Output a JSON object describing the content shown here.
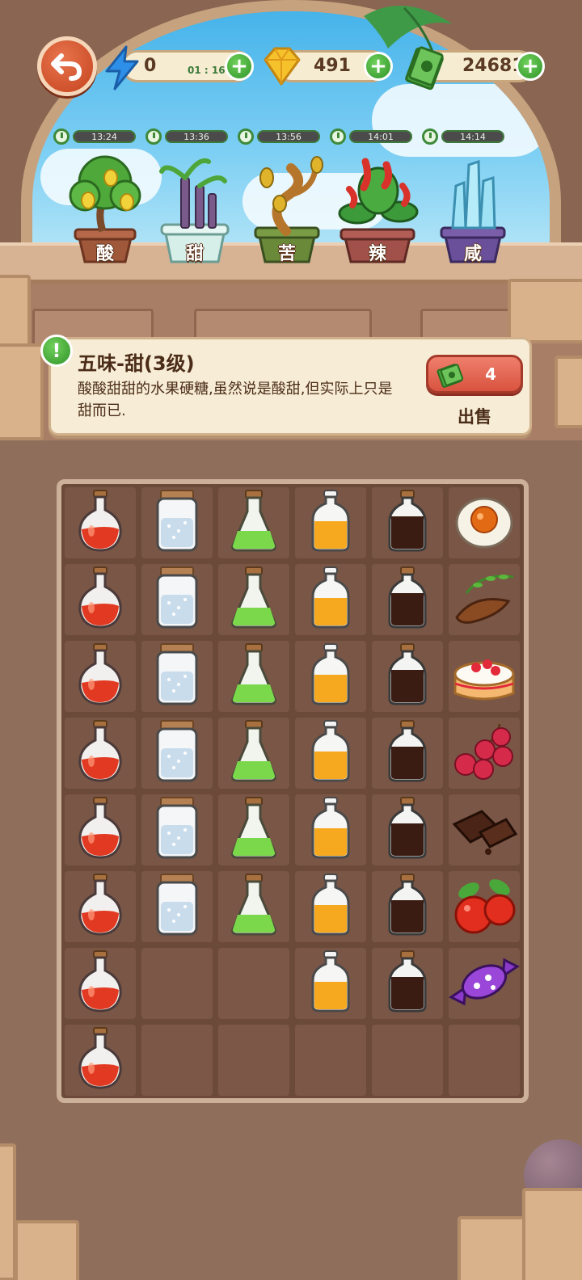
{
  "hud": {
    "energy": {
      "value": "0",
      "timer": "01 : 16",
      "icon": "lightning-bolt-icon"
    },
    "gems": {
      "value": "491",
      "icon": "gold-gem-icon"
    },
    "cash": {
      "value": "24681",
      "icon": "cash-stack-icon"
    },
    "plus_label": "+"
  },
  "plants": [
    {
      "id": "sour",
      "label": "酸",
      "timer": "13:24",
      "icon": "lemon-tree-icon"
    },
    {
      "id": "sweet",
      "label": "甜",
      "timer": "13:36",
      "icon": "sugarcane-icon"
    },
    {
      "id": "bitter",
      "label": "苦",
      "timer": "13:56",
      "icon": "bitter-gourd-tree-icon"
    },
    {
      "id": "spicy",
      "label": "辣",
      "timer": "14:01",
      "icon": "chili-plant-icon"
    },
    {
      "id": "salty",
      "label": "咸",
      "timer": "14:14",
      "icon": "salt-crystal-icon"
    }
  ],
  "info": {
    "badge": "!",
    "title": "五味-甜(3级)",
    "description": "酸酸甜甜的水果硬糖,虽然说是酸甜,但实际上只是甜而已.",
    "price": "4",
    "sell_label": "出售"
  },
  "grid": {
    "columns": [
      {
        "item": "red-potion-flask-icon",
        "count": 8
      },
      {
        "item": "sugar-jar-icon",
        "count": 6
      },
      {
        "item": "green-potion-flask-icon",
        "count": 6
      },
      {
        "item": "orange-juice-bottle-icon",
        "count": 7
      },
      {
        "item": "soy-sauce-bottle-icon",
        "count": 7
      }
    ],
    "last_column": [
      "salted-egg-icon",
      "tamarind-icon",
      "strawberry-cake-icon",
      "lychee-icon",
      "chocolate-icon",
      "hawthorn-icon",
      "wrapped-candy-icon"
    ]
  },
  "colors": {
    "accent_green": "#2f9429",
    "sell_red": "#d8533f",
    "card_bg": "#f7ecd5",
    "grid_bg": "#6b4a3a"
  }
}
